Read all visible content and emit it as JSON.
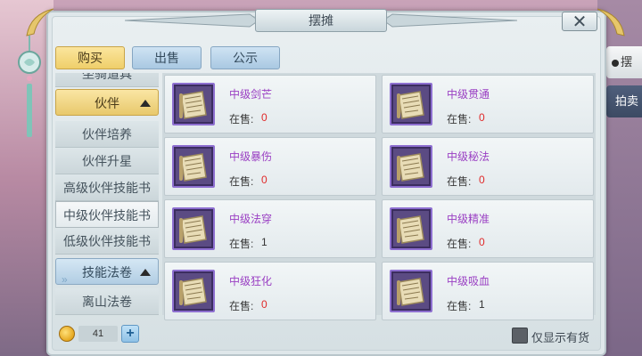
{
  "window": {
    "title": "摆摊",
    "close_label": "✕"
  },
  "top_tabs": [
    {
      "label": "购买",
      "active": true
    },
    {
      "label": "出售",
      "active": false
    },
    {
      "label": "公示",
      "active": false
    }
  ],
  "side_menu": {
    "partial_top_label": "坐骑道具",
    "items": [
      {
        "label": "伙伴",
        "kind": "category",
        "expanded": true
      },
      {
        "label": "伙伴培养",
        "kind": "sub"
      },
      {
        "label": "伙伴升星",
        "kind": "sub"
      },
      {
        "label": "高级伙伴技能书",
        "kind": "sub"
      },
      {
        "label": "中级伙伴技能书",
        "kind": "sub",
        "selected": true
      },
      {
        "label": "低级伙伴技能书",
        "kind": "sub"
      },
      {
        "label": "技能法卷",
        "kind": "category",
        "expanded": true
      },
      {
        "label": "离山法卷",
        "kind": "sub"
      }
    ]
  },
  "items": [
    {
      "name": "中级剑芒",
      "stock_label": "在售:",
      "stock": "0"
    },
    {
      "name": "中级贯通",
      "stock_label": "在售:",
      "stock": "0"
    },
    {
      "name": "中级暴伤",
      "stock_label": "在售:",
      "stock": "0"
    },
    {
      "name": "中级秘法",
      "stock_label": "在售:",
      "stock": "0"
    },
    {
      "name": "中级法穿",
      "stock_label": "在售:",
      "stock": "1"
    },
    {
      "name": "中级精准",
      "stock_label": "在售:",
      "stock": "0"
    },
    {
      "name": "中级狂化",
      "stock_label": "在售:",
      "stock": "0"
    },
    {
      "name": "中级吸血",
      "stock_label": "在售:",
      "stock": "1"
    }
  ],
  "currency": {
    "value": "41",
    "add_label": "+"
  },
  "filter": {
    "label": "仅显示有货",
    "checked": false
  },
  "right_tabs": [
    {
      "label": "摆摊",
      "active": true
    },
    {
      "label": "拍卖",
      "active": false
    }
  ],
  "colors": {
    "item_name": "#9a3fc3",
    "stock_zero": "#e02a2a",
    "stock_nonzero": "#333333",
    "active_tab": "#efcf6a",
    "inactive_tab": "#a9c8e2"
  },
  "icons": {
    "item_icon": "scroll-icon",
    "coin": "coin-icon",
    "close": "close-icon"
  }
}
